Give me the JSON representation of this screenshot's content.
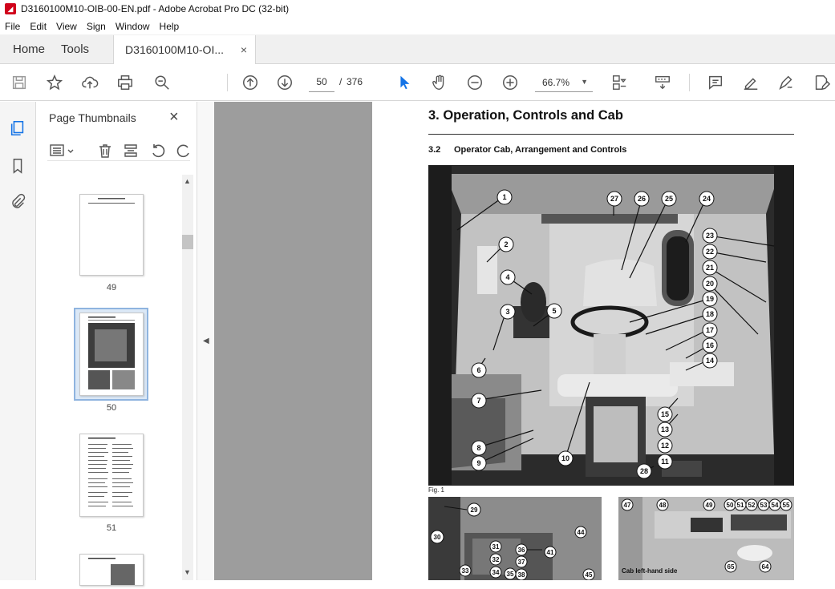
{
  "window": {
    "title": "D3160100M10-OIB-00-EN.pdf - Adobe Acrobat Pro DC (32-bit)"
  },
  "menu": [
    "File",
    "Edit",
    "View",
    "Sign",
    "Window",
    "Help"
  ],
  "tabs": {
    "home": "Home",
    "tools": "Tools",
    "document": "D3160100M10-OI...",
    "close": "×"
  },
  "toolbar": {
    "page_current": "50",
    "page_sep": "/",
    "page_total": "376",
    "zoom": "66.7%"
  },
  "panel": {
    "title": "Page Thumbnails",
    "close": "×",
    "thumbnails": [
      {
        "label": "49",
        "selected": false
      },
      {
        "label": "50",
        "selected": true
      },
      {
        "label": "51",
        "selected": false
      }
    ]
  },
  "document": {
    "heading": "3. Operation, Controls and Cab",
    "section_number": "3.2",
    "section_title": "Operator Cab, Arrangement and Controls",
    "figure_label": "Fig. 1",
    "figure3_caption": "Cab left-hand side",
    "callouts_fig1": [
      "1",
      "2",
      "3",
      "4",
      "5",
      "6",
      "7",
      "8",
      "9",
      "10",
      "11",
      "12",
      "13",
      "14",
      "15",
      "16",
      "17",
      "18",
      "19",
      "20",
      "21",
      "22",
      "23",
      "24",
      "25",
      "26",
      "27",
      "28"
    ],
    "callouts_fig2": [
      "29",
      "30",
      "31",
      "32",
      "33",
      "34",
      "35",
      "36",
      "37",
      "38",
      "41",
      "44",
      "45"
    ],
    "callouts_fig3": [
      "47",
      "48",
      "49",
      "50",
      "51",
      "52",
      "53",
      "54",
      "55",
      "64",
      "65"
    ]
  },
  "colors": {
    "accent": "#1473e6",
    "selection": "#8fb4df",
    "doc_background": "#9d9d9d"
  }
}
